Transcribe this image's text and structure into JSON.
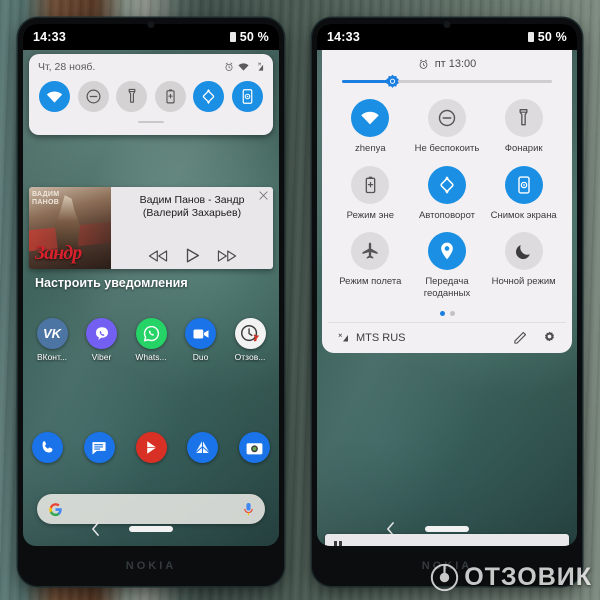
{
  "watermark": {
    "text": "ОТЗОВИК",
    "logo_icon": "otzovik-circle-logo"
  },
  "left_phone": {
    "brand": "NOKIA",
    "status_bar": {
      "time": "14:33",
      "battery_text": "50 %",
      "battery_icon": "battery-icon"
    },
    "shade": {
      "date": "Чт, 28 нояб.",
      "status_icons": [
        "alarm-icon",
        "wifi-icon",
        "cellular-signal-icon"
      ],
      "tiles": [
        {
          "name": "wifi",
          "icon": "wifi-icon",
          "state": "on"
        },
        {
          "name": "do-not-disturb",
          "icon": "do-not-disturb-icon",
          "state": "off"
        },
        {
          "name": "flashlight",
          "icon": "flashlight-icon",
          "state": "off"
        },
        {
          "name": "battery-saver",
          "icon": "battery-saver-icon",
          "state": "off"
        },
        {
          "name": "auto-rotate",
          "icon": "auto-rotate-icon",
          "state": "on"
        },
        {
          "name": "screenshot",
          "icon": "screenshot-icon",
          "state": "on"
        }
      ]
    },
    "media_notification": {
      "title": "Вадим Панов - Зандр (Валерий Захарьев)",
      "album_top_text": "ВАДИМ\nПАНОВ",
      "album_label": "Зандр",
      "close_icon": "close-icon",
      "controls": [
        {
          "name": "rewind",
          "icon": "rewind-icon"
        },
        {
          "name": "play",
          "icon": "play-icon"
        },
        {
          "name": "fast-forward",
          "icon": "fast-forward-icon"
        }
      ]
    },
    "setup_notifications_label": "Настроить уведомления",
    "apps": [
      {
        "label": "ВКонт...",
        "icon": "vk-icon",
        "color": "#4c75a3"
      },
      {
        "label": "Viber",
        "icon": "viber-icon",
        "color": "#7360f2"
      },
      {
        "label": "Whats...",
        "icon": "whatsapp-icon",
        "color": "#25d366"
      },
      {
        "label": "Duo",
        "icon": "duo-icon",
        "color": "#1a73e8"
      },
      {
        "label": "Отзов...",
        "icon": "otzovik-app-icon",
        "color": "#f2f2f2"
      }
    ],
    "dock": [
      {
        "name": "phone",
        "icon": "phone-icon",
        "color": "#1a73e8"
      },
      {
        "name": "messages",
        "icon": "messages-icon",
        "color": "#1a73e8"
      },
      {
        "name": "play-store",
        "icon": "play-store-icon",
        "color": "#d93025"
      },
      {
        "name": "drive",
        "icon": "drive-icon",
        "color": "#1a73e8"
      },
      {
        "name": "camera",
        "icon": "camera-icon",
        "color": "#1a73e8"
      }
    ],
    "search_bar": {
      "google_icon": "google-g-icon",
      "mic_icon": "microphone-icon"
    },
    "nav": {
      "back_icon": "back-chevron-icon",
      "home_pill": "home-pill"
    }
  },
  "right_phone": {
    "brand": "NOKIA",
    "status_bar": {
      "time": "14:33",
      "battery_text": "50 %",
      "battery_icon": "battery-icon"
    },
    "alarm": {
      "icon": "alarm-icon",
      "text": "пт 13:00"
    },
    "brightness": {
      "icon": "brightness-slider-thumb",
      "percent": 24
    },
    "tiles": [
      {
        "label": "zhenya",
        "icon": "wifi-icon",
        "state": "on"
      },
      {
        "label": "Не беспокоить",
        "icon": "do-not-disturb-icon",
        "state": "off"
      },
      {
        "label": "Фонарик",
        "icon": "flashlight-icon",
        "state": "off"
      },
      {
        "label": "Режим эне",
        "icon": "battery-saver-icon",
        "state": "off"
      },
      {
        "label": "Автоповорот",
        "icon": "auto-rotate-icon",
        "state": "on"
      },
      {
        "label": "Снимок экрана",
        "icon": "screenshot-icon",
        "state": "on"
      },
      {
        "label": "Режим полета",
        "icon": "airplane-icon",
        "state": "off"
      },
      {
        "label": "Передача геоданных",
        "icon": "location-pin-icon",
        "state": "on"
      },
      {
        "label": "Ночной режим",
        "icon": "moon-icon",
        "state": "off"
      }
    ],
    "pages": {
      "count": 2,
      "active": 1
    },
    "footer": {
      "carrier": "MTS RUS",
      "signal_icon": "cellular-signal-icon",
      "edit_icon": "pencil-edit-icon",
      "settings_icon": "gear-icon"
    },
    "media_bar": {
      "pause_icon": "pause-icon"
    },
    "nav": {
      "back_icon": "back-chevron-icon",
      "home_pill": "home-pill"
    }
  },
  "colors": {
    "accent": "#1a8fe3",
    "tile_off": "#d8d5d8",
    "shade_bg": "#f0eef0"
  }
}
